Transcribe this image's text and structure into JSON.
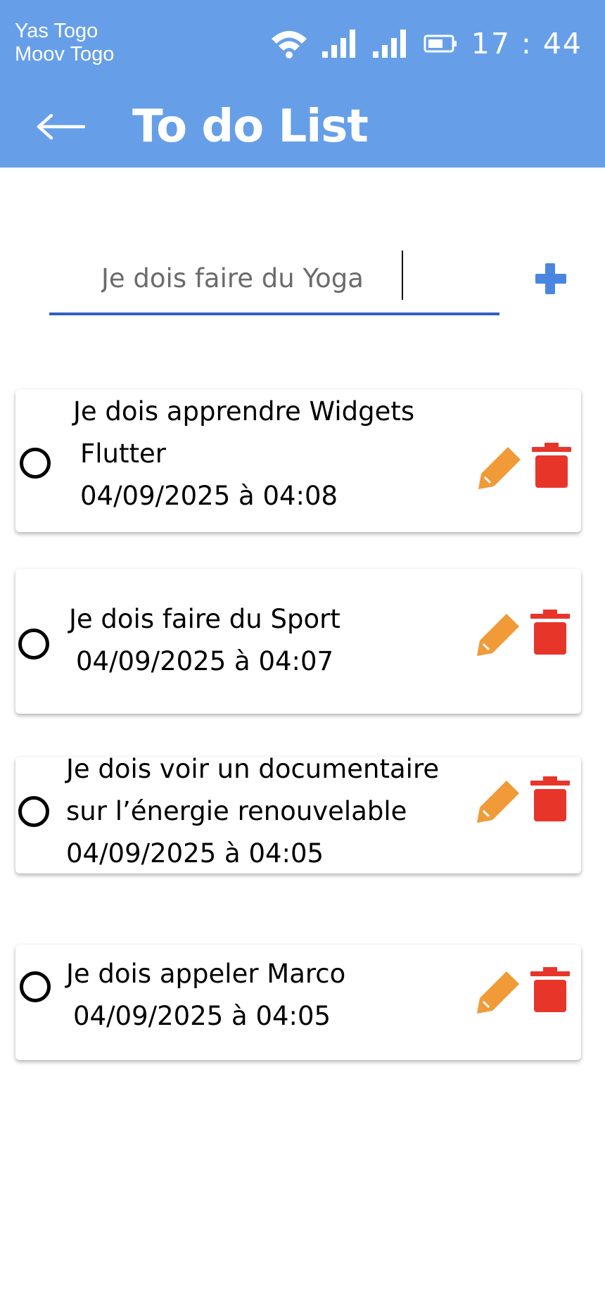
{
  "status_bar": {
    "carrier_1": "Yas Togo",
    "carrier_2": "Moov Togo",
    "time": "17 : 44",
    "icons": [
      "wifi-icon",
      "signal-icon",
      "signal-icon",
      "battery-icon"
    ]
  },
  "app_bar": {
    "title": "To do List",
    "back_icon": "arrow-left-icon",
    "color": "#669fe8"
  },
  "input": {
    "value": "Je dois faire du Yoga",
    "add_icon": "plus-icon",
    "accent": "#3060bf"
  },
  "tasks": [
    {
      "lines": [
        "Je dois apprendre Widgets",
        " Flutter"
      ],
      "date": "04/09/2025 à 04:08"
    },
    {
      "lines": [
        "Je dois faire du Sport"
      ],
      "date": "04/09/2025 à 04:07"
    },
    {
      "lines": [
        "Je dois voir un documentaire",
        "sur l’énergie renouvelable"
      ],
      "date": "04/09/2025 à 04:05"
    },
    {
      "lines": [
        "Je dois appeler Marco"
      ],
      "date": "04/09/2025 à 04:05"
    }
  ],
  "colors": {
    "edit": "#f09a38",
    "delete": "#e8352a"
  }
}
